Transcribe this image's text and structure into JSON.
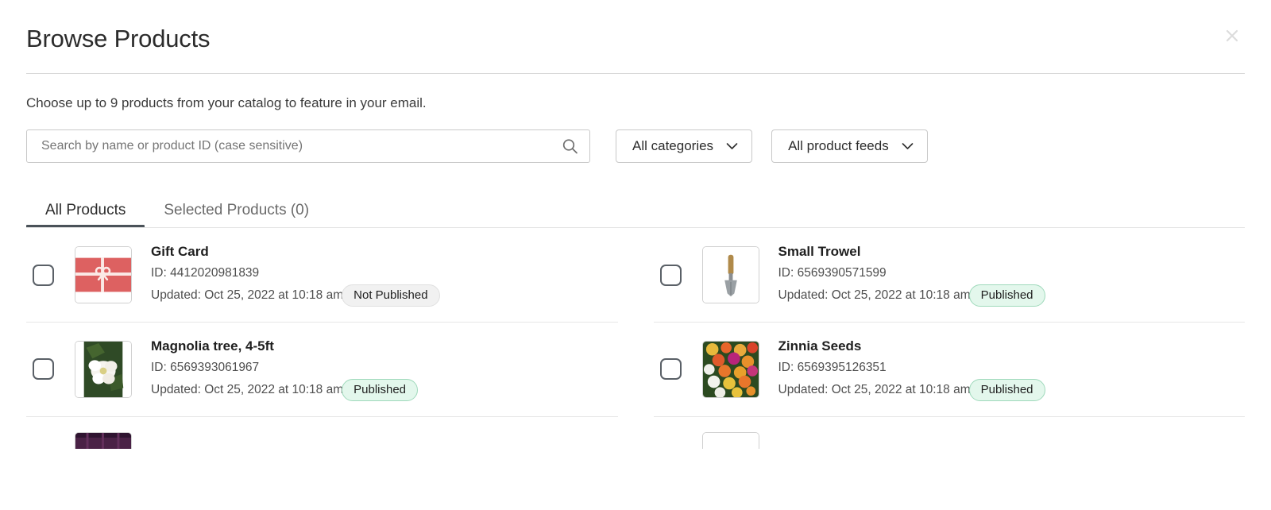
{
  "modal": {
    "title": "Browse Products",
    "close_icon": "close-icon",
    "subtitle": "Choose up to 9 products from your catalog to feature in your email."
  },
  "search": {
    "placeholder": "Search by name or product ID (case sensitive)",
    "value": "",
    "icon": "search-icon"
  },
  "filters": [
    {
      "label": "All categories",
      "icon": "chevron-down-icon"
    },
    {
      "label": "All product feeds",
      "icon": "chevron-down-icon"
    }
  ],
  "tabs": [
    {
      "label": "All Products",
      "active": true
    },
    {
      "label": "Selected Products (0)",
      "active": false
    }
  ],
  "products": [
    {
      "name": "Gift Card",
      "id_label": "ID: 4412020981839",
      "updated_label": "Updated: Oct 25, 2022 at 10:18 am",
      "status": "Not Published",
      "status_kind": "unpublished",
      "thumb": "gift-card-thumbnail",
      "checked": false
    },
    {
      "name": "Small Trowel",
      "id_label": "ID: 6569390571599",
      "updated_label": "Updated: Oct 25, 2022 at 10:18 am",
      "status": "Published",
      "status_kind": "published",
      "thumb": "small-trowel-thumbnail",
      "checked": false
    },
    {
      "name": "Magnolia tree, 4-5ft",
      "id_label": "ID: 6569393061967",
      "updated_label": "Updated: Oct 25, 2022 at 10:18 am",
      "status": "Published",
      "status_kind": "published",
      "thumb": "magnolia-tree-thumbnail",
      "checked": false
    },
    {
      "name": "Zinnia Seeds",
      "id_label": "ID: 6569395126351",
      "updated_label": "Updated: Oct 25, 2022 at 10:18 am",
      "status": "Published",
      "status_kind": "published",
      "thumb": "zinnia-seeds-thumbnail",
      "checked": false
    }
  ],
  "colors": {
    "published_bg": "#e3f7ec",
    "published_border": "#9fd9bb",
    "unpublished_bg": "#f1f1f1",
    "tab_active_underline": "#4a5259",
    "gift_card_red": "#dd6161",
    "text_primary": "#1f1f1f",
    "text_secondary": "#4e4e4e"
  }
}
